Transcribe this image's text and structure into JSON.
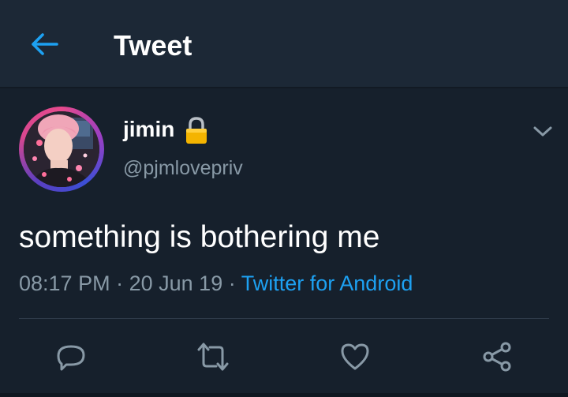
{
  "header": {
    "title": "Tweet",
    "back_icon": "arrow-left-icon"
  },
  "tweet": {
    "user": {
      "name": "jimin",
      "handle": "@pjmlovepriv",
      "protected_icon": "lock-icon"
    },
    "text": "something is bothering me",
    "time": "08:17 PM",
    "date": "20 Jun 19",
    "source": "Twitter for Android",
    "separator": "·"
  },
  "actions": [
    {
      "name": "reply",
      "icon": "reply-icon"
    },
    {
      "name": "retweet",
      "icon": "retweet-icon"
    },
    {
      "name": "like",
      "icon": "heart-icon"
    },
    {
      "name": "share",
      "icon": "share-icon"
    }
  ],
  "colors": {
    "background": "#16202c",
    "header_background": "#1c2836",
    "accent": "#1da1f2",
    "secondary_text": "#8899a6",
    "icon": "#8899a6"
  }
}
